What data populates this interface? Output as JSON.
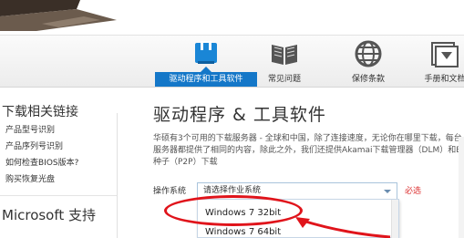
{
  "tabs": [
    {
      "label": "驱动程序和工具软件",
      "icon": "download-icon",
      "active": true
    },
    {
      "label": "常见问题",
      "icon": "book-icon",
      "active": false
    },
    {
      "label": "保修条款",
      "icon": "globe-icon",
      "active": false
    },
    {
      "label": "手册和文档",
      "icon": "folder-icon",
      "active": false
    }
  ],
  "sidebar": {
    "heading": "下载相关链接",
    "links": [
      "产品型号识别",
      "产品序列号识别",
      "如何检查BIOS版本?",
      "购买恢复光盘"
    ],
    "heading2": "Microsoft 支持"
  },
  "main": {
    "title": "驱动程序 & 工具软件",
    "description": "华硕有3个可用的下载服务器 - 全球和中国，除了连接速度，无论你在哪里下载，每台服务器都提供了相同的内容，除此之外，我们还提供Akamai下载管理器（DLM）和BT种子（P2P）下载",
    "os_label": "操作系统",
    "os_placeholder": "请选择作业系统",
    "required": "必选",
    "os_options": [
      "Windows 7 32bit",
      "Windows 7 64bit"
    ]
  },
  "colors": {
    "accent": "#1477c8",
    "highlight": "#e0141b"
  }
}
